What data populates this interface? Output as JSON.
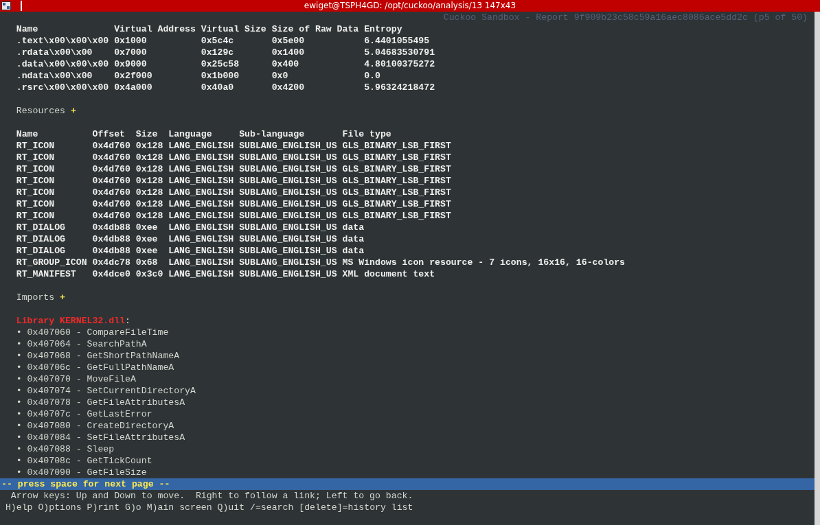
{
  "window": {
    "title": "ewiget@TSPH4GD: /opt/cuckoo/analysis/13 147x43"
  },
  "header": "Cuckoo Sandbox - Report 9f909b23c58c59a16aec8086ace5dd2c (p5 of 50)",
  "sections": {
    "columns": [
      "Name",
      "Virtual Address",
      "Virtual Size",
      "Size of Raw Data",
      "Entropy"
    ],
    "rows": [
      [
        ".text\\x00\\x00\\x00",
        "0x1000",
        "0x5c4c",
        "0x5e00",
        "6.4401055495"
      ],
      [
        ".rdata\\x00\\x00",
        "0x7000",
        "0x129c",
        "0x1400",
        "5.04683530791"
      ],
      [
        ".data\\x00\\x00\\x00",
        "0x9000",
        "0x25c58",
        "0x400",
        "4.80100375272"
      ],
      [
        ".ndata\\x00\\x00",
        "0x2f000",
        "0x1b000",
        "0x0",
        "0.0"
      ],
      [
        ".rsrc\\x00\\x00\\x00",
        "0x4a000",
        "0x40a0",
        "0x4200",
        "5.96324218472"
      ]
    ]
  },
  "resources": {
    "heading": "Resources",
    "expander": "+",
    "columns": [
      "Name",
      "Offset",
      "Size",
      "Language",
      "Sub-language",
      "File type"
    ],
    "rows": [
      [
        "RT_ICON",
        "0x4d760",
        "0x128",
        "LANG_ENGLISH",
        "SUBLANG_ENGLISH_US",
        "GLS_BINARY_LSB_FIRST"
      ],
      [
        "RT_ICON",
        "0x4d760",
        "0x128",
        "LANG_ENGLISH",
        "SUBLANG_ENGLISH_US",
        "GLS_BINARY_LSB_FIRST"
      ],
      [
        "RT_ICON",
        "0x4d760",
        "0x128",
        "LANG_ENGLISH",
        "SUBLANG_ENGLISH_US",
        "GLS_BINARY_LSB_FIRST"
      ],
      [
        "RT_ICON",
        "0x4d760",
        "0x128",
        "LANG_ENGLISH",
        "SUBLANG_ENGLISH_US",
        "GLS_BINARY_LSB_FIRST"
      ],
      [
        "RT_ICON",
        "0x4d760",
        "0x128",
        "LANG_ENGLISH",
        "SUBLANG_ENGLISH_US",
        "GLS_BINARY_LSB_FIRST"
      ],
      [
        "RT_ICON",
        "0x4d760",
        "0x128",
        "LANG_ENGLISH",
        "SUBLANG_ENGLISH_US",
        "GLS_BINARY_LSB_FIRST"
      ],
      [
        "RT_ICON",
        "0x4d760",
        "0x128",
        "LANG_ENGLISH",
        "SUBLANG_ENGLISH_US",
        "GLS_BINARY_LSB_FIRST"
      ],
      [
        "RT_DIALOG",
        "0x4db88",
        "0xee",
        "LANG_ENGLISH",
        "SUBLANG_ENGLISH_US",
        "data"
      ],
      [
        "RT_DIALOG",
        "0x4db88",
        "0xee",
        "LANG_ENGLISH",
        "SUBLANG_ENGLISH_US",
        "data"
      ],
      [
        "RT_DIALOG",
        "0x4db88",
        "0xee",
        "LANG_ENGLISH",
        "SUBLANG_ENGLISH_US",
        "data"
      ],
      [
        "RT_GROUP_ICON",
        "0x4dc78",
        "0x68",
        "LANG_ENGLISH",
        "SUBLANG_ENGLISH_US",
        "MS Windows icon resource - 7 icons, 16x16, 16-colors"
      ],
      [
        "RT_MANIFEST",
        "0x4dce0",
        "0x3c0",
        "LANG_ENGLISH",
        "SUBLANG_ENGLISH_US",
        "XML document text"
      ]
    ]
  },
  "imports": {
    "heading": "Imports",
    "expander": "+",
    "library": "Library KERNEL32.dll",
    "library_suffix": ":",
    "bullet": "•",
    "functions": [
      "0x407060 - CompareFileTime",
      "0x407064 - SearchPathA",
      "0x407068 - GetShortPathNameA",
      "0x40706c - GetFullPathNameA",
      "0x407070 - MoveFileA",
      "0x407074 - SetCurrentDirectoryA",
      "0x407078 - GetFileAttributesA",
      "0x40707c - GetLastError",
      "0x407080 - CreateDirectoryA",
      "0x407084 - SetFileAttributesA",
      "0x407088 - Sleep",
      "0x40708c - GetTickCount",
      "0x407090 - GetFileSize"
    ]
  },
  "status_bar": {
    "prompt": "-- press space for next page --",
    "help_lines": [
      "Arrow keys: Up and Down to move.  Right to follow a link; Left to go back.",
      "H)elp O)ptions P)rint G)o M)ain screen Q)uit /=search [delete]=history list"
    ]
  }
}
